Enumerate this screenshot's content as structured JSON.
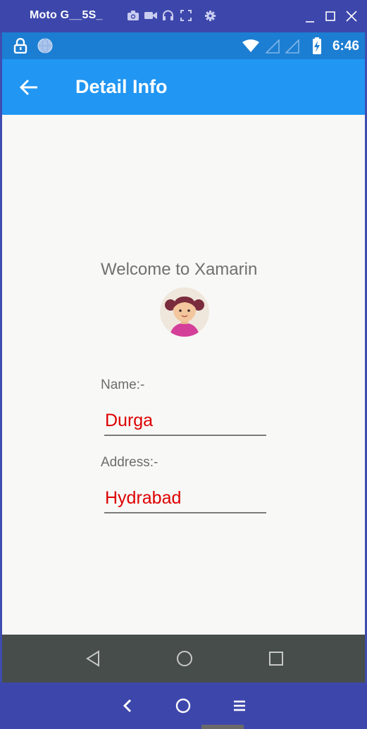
{
  "window": {
    "title": "Moto G__5S_",
    "icons": [
      "camera-icon",
      "video-icon",
      "headphones-icon",
      "fullscreen-icon",
      "gear-icon"
    ],
    "controls": [
      "minimize-icon",
      "maximize-icon",
      "close-icon"
    ]
  },
  "status_bar": {
    "time": "6:46",
    "icons": [
      "lock-icon",
      "globe-icon",
      "wifi-icon",
      "signal-icon",
      "signal-icon",
      "battery-charging-icon"
    ]
  },
  "app_bar": {
    "title": "Detail Info",
    "back_icon": "arrow-left-icon"
  },
  "main": {
    "welcome": "Welcome to Xamarin",
    "avatar_icon": "girl-avatar-icon",
    "name_label": "Name:-",
    "name_value": "Durga",
    "address_label": "Address:-",
    "address_value": "Hydrabad"
  },
  "device_nav": [
    "back-triangle-icon",
    "home-circle-icon",
    "recents-square-icon"
  ],
  "emulator_nav": [
    "chevron-left-icon",
    "home-circle-icon",
    "menu-icon"
  ],
  "colors": {
    "app_bar": "#2196f3",
    "status_bar": "#1c7ed2",
    "window_bar": "#3d47ab",
    "field_text": "#dd0000",
    "device_nav": "#464d4b"
  }
}
